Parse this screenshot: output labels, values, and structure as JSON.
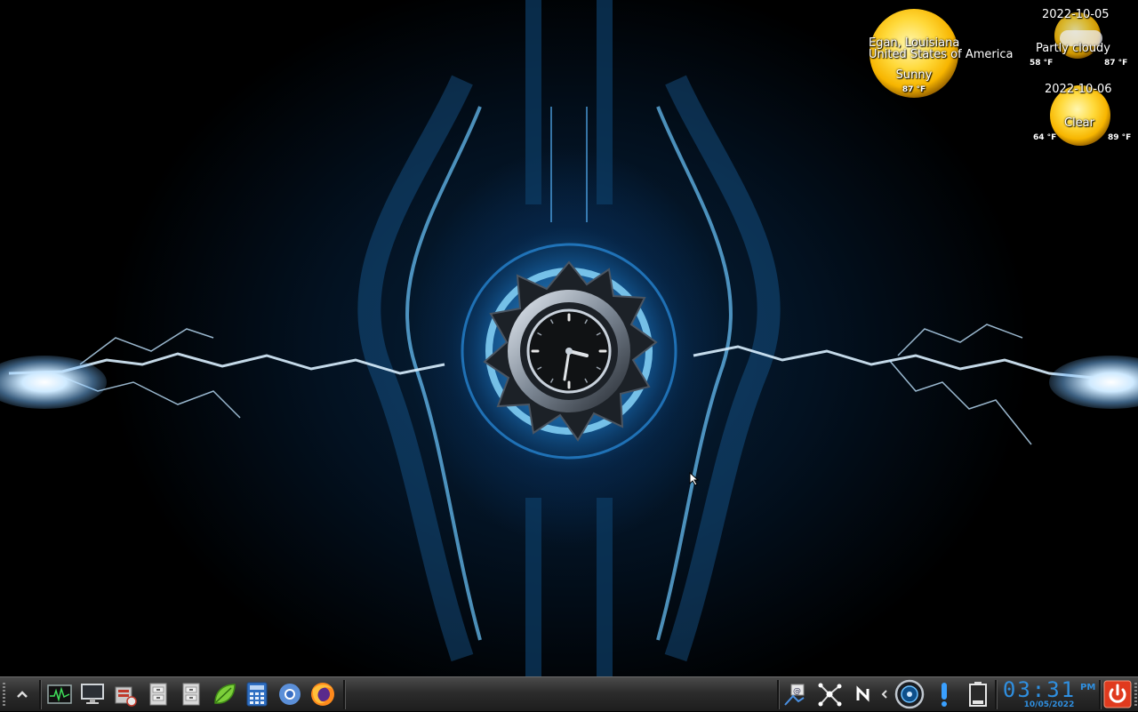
{
  "weather": {
    "location_line1": "Egan, Louisiana",
    "location_line2": "United States of America",
    "current": {
      "condition": "Sunny",
      "temp": "87 °F"
    },
    "forecast": [
      {
        "date": "2022-10-05",
        "condition": "Partly cloudy",
        "low": "58 °F",
        "high": "87 °F"
      },
      {
        "date": "2022-10-06",
        "condition": "Clear",
        "low": "64 °F",
        "high": "89 °F"
      }
    ]
  },
  "taskbar": {
    "launchers": [
      {
        "icon": "system-monitor-icon"
      },
      {
        "icon": "display-icon"
      },
      {
        "icon": "package-installer-icon"
      },
      {
        "icon": "file-cabinet-icon"
      },
      {
        "icon": "file-cabinet-icon"
      },
      {
        "icon": "leaf-icon"
      },
      {
        "icon": "calculator-icon"
      },
      {
        "icon": "chromium-icon"
      },
      {
        "icon": "firefox-icon"
      }
    ],
    "tray": [
      {
        "icon": "network-settings-icon"
      },
      {
        "icon": "network-graph-icon"
      },
      {
        "icon": "n-app-icon"
      },
      {
        "icon": "chevron-left-icon"
      },
      {
        "icon": "speaker-volume-icon"
      },
      {
        "icon": "exclamation-icon"
      },
      {
        "icon": "battery-icon"
      }
    ],
    "clock": {
      "time": "03:31",
      "ampm": "PM",
      "date": "10/05/2022"
    },
    "power_icon": "power-icon"
  },
  "colors": {
    "clock_blue": "#2f8fe0",
    "power_red": "#e03a1e",
    "accent_blue": "#3aa0ff"
  }
}
